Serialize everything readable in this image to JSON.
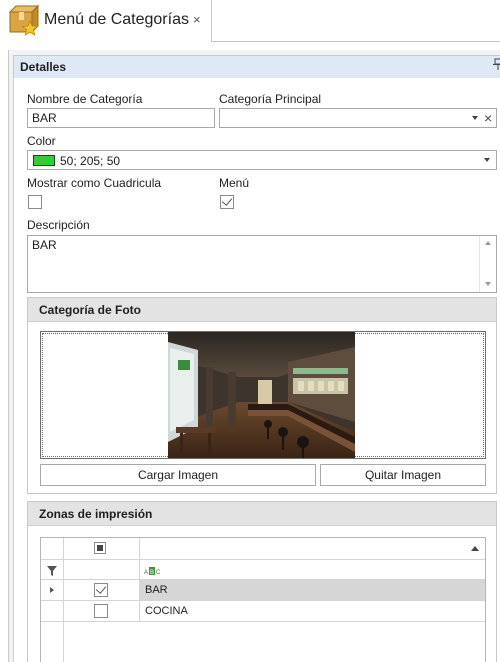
{
  "tab": {
    "title": "Menú de Categorías",
    "close_glyph": "×",
    "icon": "box-star-icon"
  },
  "panel": {
    "title": "Detalles",
    "pin_glyph": "⊓",
    "pin_icon": "pin-icon"
  },
  "form": {
    "nombre_label": "Nombre de Categoría",
    "nombre_value": "BAR",
    "principal_label": "Categoría Principal",
    "principal_value": "",
    "clear_glyph": "×",
    "color_label": "Color",
    "color_value": "50; 205; 50",
    "color_swatch": "#32cd32",
    "cuadricula_label": "Mostrar como Cuadricula",
    "cuadricula_checked": false,
    "menu_label": "Menú",
    "menu_checked": true,
    "descripcion_label": "Descripción",
    "descripcion_value": "BAR"
  },
  "foto": {
    "title": "Categoría de Foto",
    "load_button": "Cargar Imagen",
    "remove_button": "Quitar Imagen"
  },
  "zonas": {
    "title": "Zonas de impresión",
    "filter_icon": "filter-icon",
    "text_type_icon": "abc-icon",
    "text_type_label": "ABC",
    "rows": [
      {
        "checked": true,
        "name": "BAR",
        "selected": true
      },
      {
        "checked": false,
        "name": "COCINA",
        "selected": false
      }
    ]
  }
}
